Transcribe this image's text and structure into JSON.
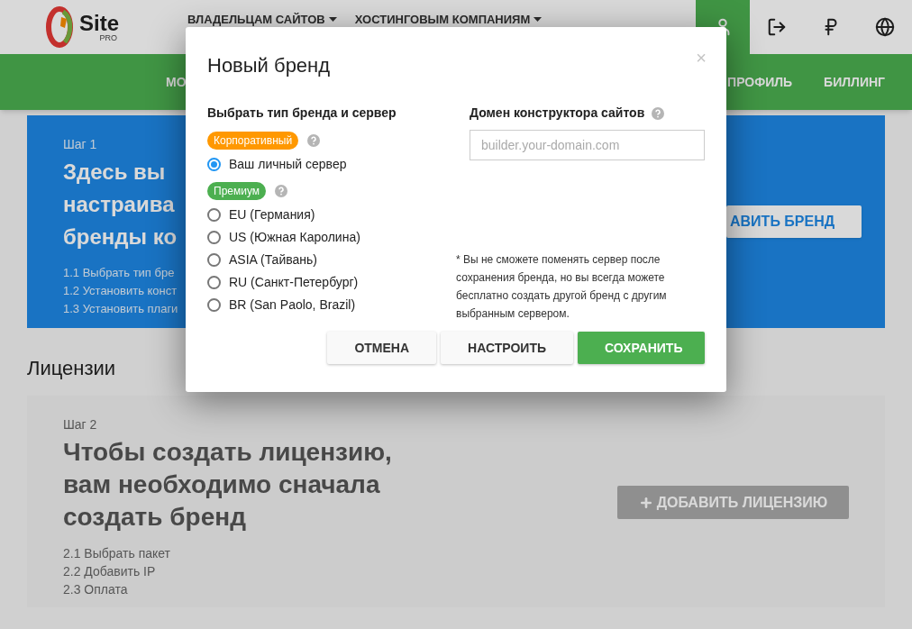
{
  "header": {
    "logo": {
      "name": "Site",
      "sub": "PRO"
    },
    "nav": [
      {
        "label": "ВЛАДЕЛЬЦАМ САЙТОВ"
      },
      {
        "label": "ХОСТИНГОВЫМ КОМПАНИЯМ"
      }
    ],
    "tools": [
      {
        "kind": "user",
        "selected": true
      },
      {
        "kind": "logout",
        "selected": false
      },
      {
        "kind": "ruble",
        "selected": false
      },
      {
        "kind": "globe",
        "selected": false
      }
    ]
  },
  "subnav": [
    {
      "label": "МО"
    },
    {
      "label": "ПРОФИЛЬ"
    },
    {
      "label": "БИЛЛИНГ"
    }
  ],
  "step1": {
    "step": "Шаг 1",
    "title_lines": [
      "Здесь вы",
      "настраива",
      "бренды ко"
    ],
    "items": [
      "1.1 Выбрать тип бре",
      "1.2 Установить конст",
      "1.3 Установить плаги"
    ],
    "button": {
      "label": "АВИТЬ БРЕНД",
      "disabled": false
    }
  },
  "section_title": "Лицензии",
  "step2": {
    "step": "Шаг 2",
    "title_lines": [
      "Чтобы создать лицензию,",
      "вам необходимо сначала",
      "создать бренд"
    ],
    "items": [
      "2.1 Выбрать пакет",
      "2.2 Добавить IP",
      "2.3 Оплата"
    ],
    "button": {
      "label": "ДОБАВИТЬ ЛИЦЕНЗИЮ",
      "disabled": true
    }
  },
  "modal": {
    "title": "Новый бренд",
    "close": "×",
    "left_heading": "Выбрать тип бренда и сервер",
    "groups": [
      {
        "badge": "Корпоративный",
        "color": "#ff9800",
        "options": [
          {
            "label": "Ваш личный сервер",
            "selected": true
          }
        ]
      },
      {
        "badge": "Премиум",
        "color": "#4caf50",
        "options": [
          {
            "label": "EU (Германия)",
            "selected": false
          },
          {
            "label": "US (Южная Каролина)",
            "selected": false
          },
          {
            "label": "ASIA (Тайвань)",
            "selected": false
          },
          {
            "label": "RU (Санкт-Петербург)",
            "selected": false
          },
          {
            "label": "BR (San Paolo, Brazil)",
            "selected": false
          }
        ]
      }
    ],
    "right_heading": "Домен конструктора сайтов",
    "domain_field": {
      "placeholder": "builder.your-domain.com"
    },
    "note": "* Вы не сможете поменять сервер после сохранения бренда, но вы всегда можете бесплатно создать другой бренд с другим выбранным сервером.",
    "buttons": [
      {
        "label": "ОТМЕНА",
        "kind": "default"
      },
      {
        "label": "НАСТРОИТЬ",
        "kind": "default"
      },
      {
        "label": "СОХРАНИТЬ",
        "kind": "primary"
      }
    ]
  }
}
